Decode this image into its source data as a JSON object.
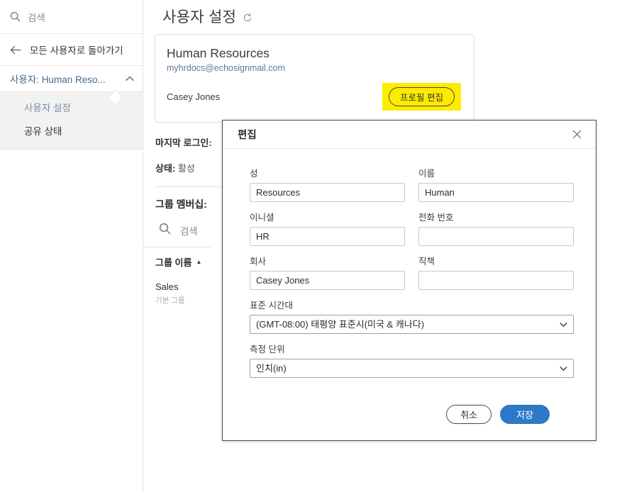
{
  "sidebar": {
    "search": {
      "placeholder": "검색",
      "icon": "search-icon"
    },
    "back": {
      "label": "모든 사용자로 돌아가기",
      "icon": "arrow-left-icon"
    },
    "user_group": {
      "label": "사용자: Human Reso...",
      "icon": "chevron-up-icon"
    },
    "sub_items": [
      {
        "label": "사용자 설정",
        "active": true
      },
      {
        "label": "공유 상태",
        "active": false
      }
    ]
  },
  "main": {
    "page_title": "사용자 설정",
    "refresh_icon": "refresh-icon",
    "profile_card": {
      "name": "Human Resources",
      "email": "myhrdocs@echosignmail.com",
      "contact": "Casey Jones",
      "edit_button": "프로필 편집",
      "highlight_color": "#ffeb00"
    },
    "details": [
      {
        "label": "마지막 로그인:",
        "value": ""
      },
      {
        "label": "상태:",
        "value": "활성"
      }
    ],
    "group_membership": {
      "title": "그룹 멤버십:",
      "search_placeholder": "검색",
      "column_header": "그룹 이름",
      "sort_caret": "▲",
      "rows": [
        {
          "name": "Sales",
          "sub": "기본 그룹"
        }
      ]
    }
  },
  "modal": {
    "title": "편집",
    "close_icon": "close-icon",
    "fields": {
      "last_name": {
        "label": "성",
        "value": "Resources",
        "placeholder": ""
      },
      "first_name": {
        "label": "이름",
        "value": "Human",
        "placeholder": ""
      },
      "initials": {
        "label": "이니셜",
        "value": "HR",
        "placeholder": ""
      },
      "phone": {
        "label": "전화 번호",
        "value": "",
        "placeholder": ""
      },
      "company": {
        "label": "회사",
        "value": "Casey Jones",
        "placeholder": ""
      },
      "job_title": {
        "label": "직책",
        "value": "",
        "placeholder": ""
      },
      "timezone": {
        "label": "표준 시간대",
        "selected": "(GMT-08:00) 태평양 표준시(미국 & 캐나다)",
        "options": [
          "(GMT-08:00) 태평양 표준시(미국 & 캐나다)"
        ]
      },
      "units": {
        "label": "측정 단위",
        "selected": "인치(in)",
        "options": [
          "인치(in)"
        ]
      }
    },
    "buttons": {
      "cancel": "취소",
      "save": "저장",
      "save_color": "#2e78c8"
    }
  }
}
